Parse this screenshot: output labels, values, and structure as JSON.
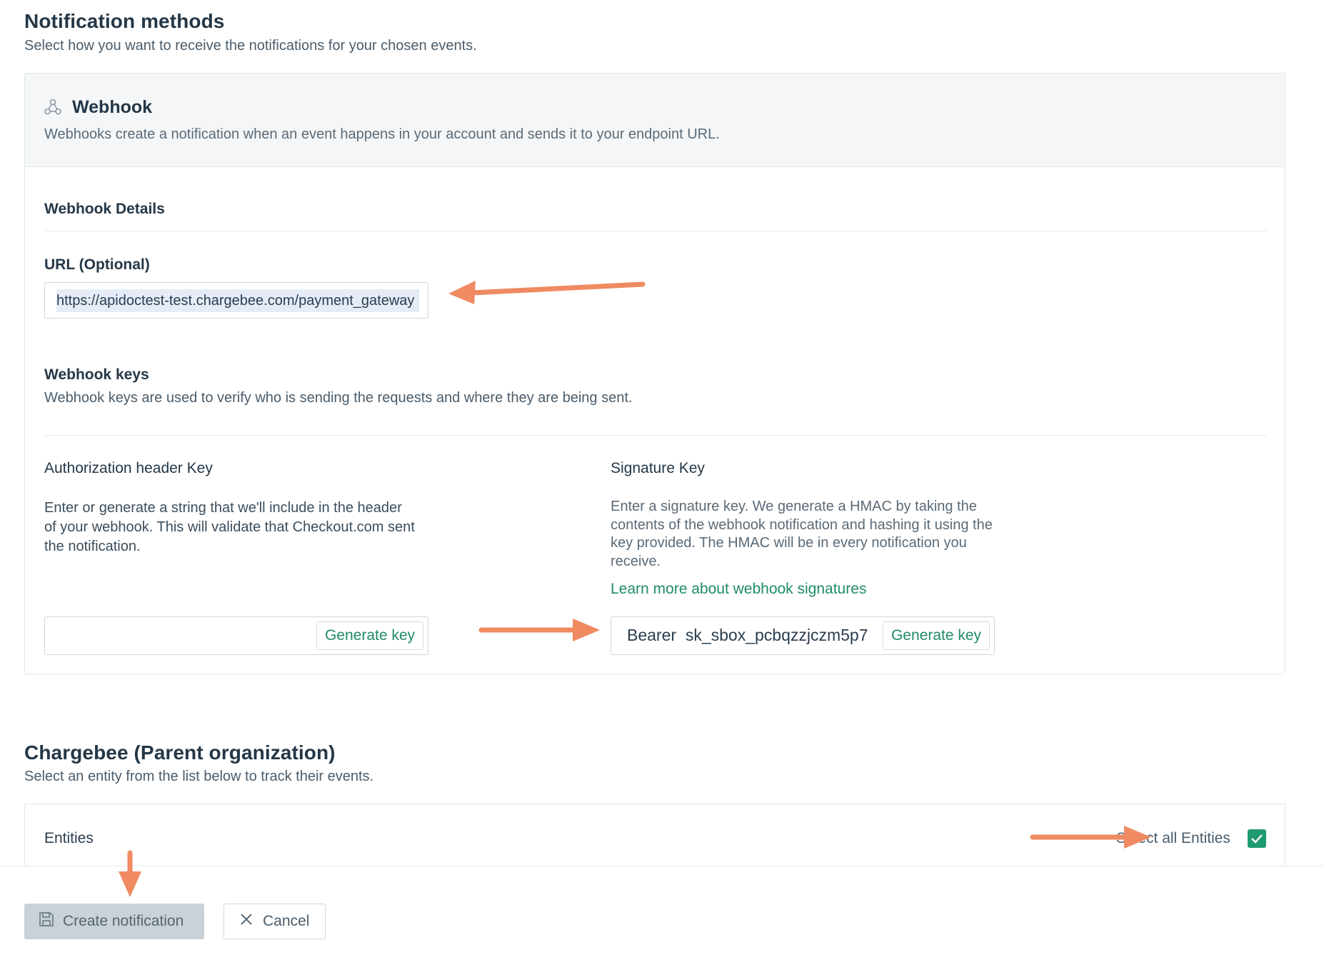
{
  "notification_methods": {
    "title": "Notification methods",
    "subtitle": "Select how you want to receive the notifications for your chosen events."
  },
  "webhook": {
    "icon": "webhook-icon",
    "title": "Webhook",
    "description": "Webhooks create a notification when an event happens in your account and sends it to your endpoint URL.",
    "details_label": "Webhook Details",
    "url_label": "URL (Optional)",
    "url_value": "https://apidoctest-test.chargebee.com/payment_gateway",
    "keys_title": "Webhook keys",
    "keys_description": "Webhook keys are used to verify who is sending the requests and where they are being sent.",
    "auth_key": {
      "label": "Authorization header Key",
      "description": "Enter or generate a string that we'll include in the header of your webhook. This will validate that Checkout.com sent the notification.",
      "value": "",
      "button": "Generate key"
    },
    "signature_key": {
      "label": "Signature Key",
      "description": "Enter a signature key. We generate a HMAC by taking the contents of the webhook notification and hashing it using the key provided. The HMAC will be in every notification you receive.",
      "link": "Learn more about webhook signatures",
      "value": "Bearer  sk_sbox_pcbqzzjczm5p7",
      "button": "Generate key"
    }
  },
  "parent_org": {
    "title": "Chargebee (Parent organization)",
    "subtitle": "Select an entity from the list below to track their events.",
    "entities_label": "Entities",
    "select_all_label": "Select all Entities",
    "select_all_checked": true
  },
  "actions": {
    "create_label": "Create notification",
    "cancel_label": "Cancel"
  },
  "colors": {
    "accent": "#1f8a6a",
    "arrow": "#f08a62",
    "checkbox": "#1f9b6f"
  }
}
